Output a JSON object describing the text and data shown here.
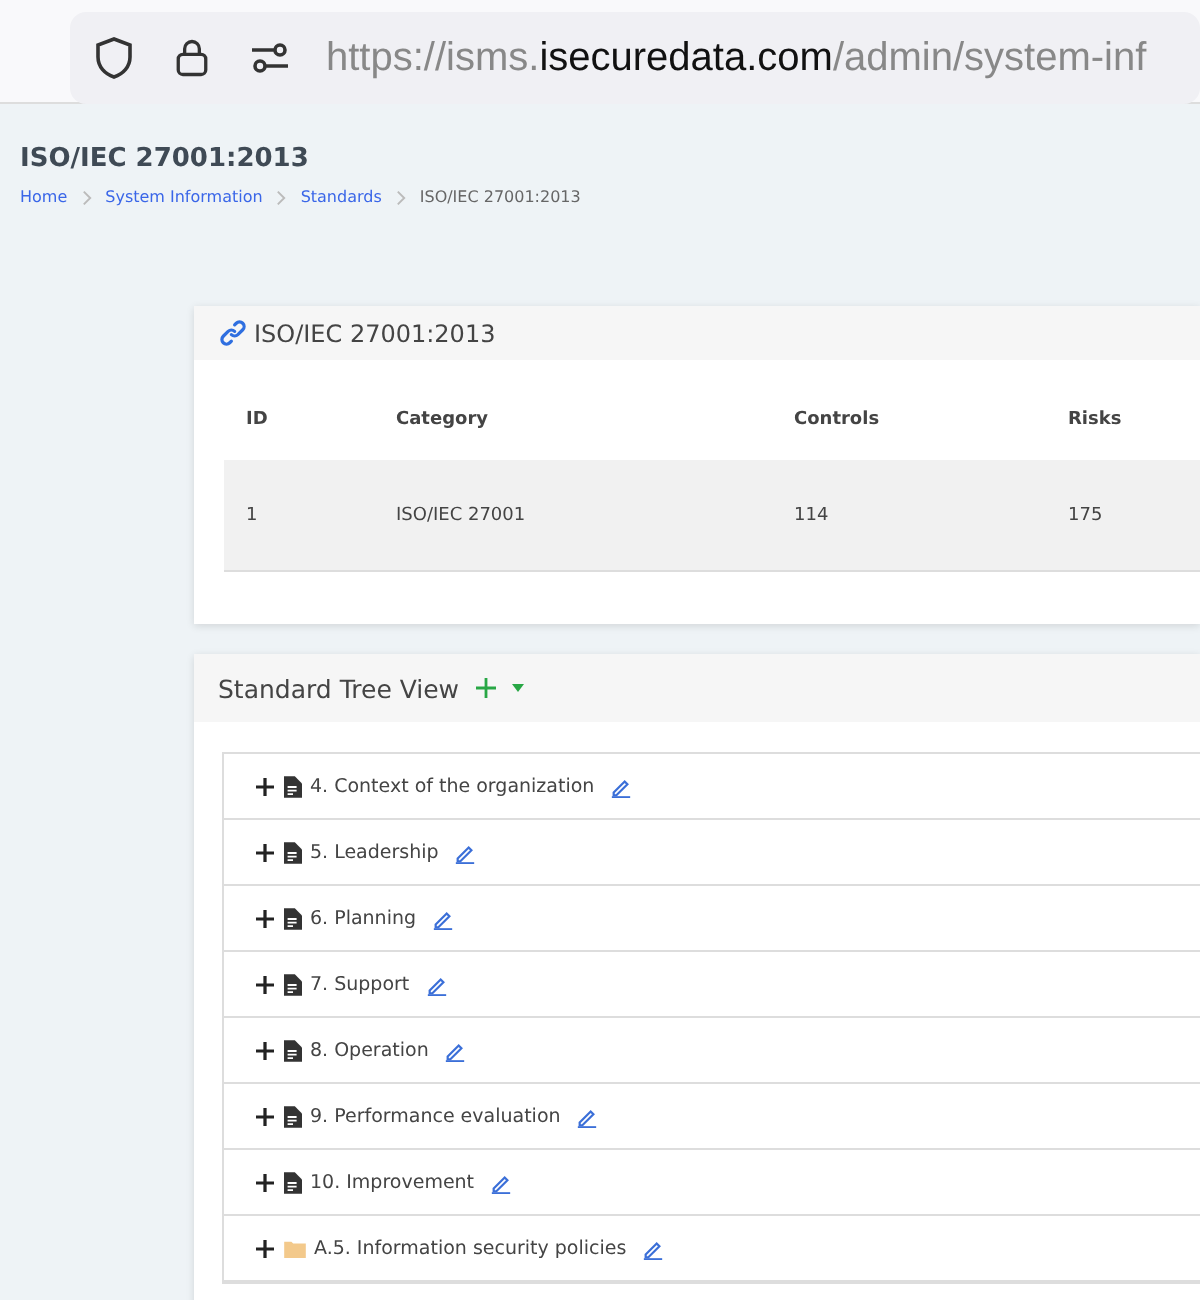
{
  "browser": {
    "url": {
      "prefix": "https://isms.",
      "domain": "isecuredata.com",
      "path": "/admin/system-inf"
    }
  },
  "page": {
    "title": "ISO/IEC 27001:2013",
    "breadcrumb": [
      {
        "label": "Home",
        "link": true
      },
      {
        "label": "System Information",
        "link": true
      },
      {
        "label": "Standards",
        "link": true
      },
      {
        "label": "ISO/IEC 27001:2013",
        "link": false
      }
    ]
  },
  "standard_card": {
    "title": "ISO/IEC 27001:2013",
    "table": {
      "columns": [
        "ID",
        "Category",
        "Controls",
        "Risks"
      ],
      "rows": [
        [
          "1",
          "ISO/IEC 27001",
          "114",
          "175"
        ]
      ]
    }
  },
  "tree_card": {
    "title": "Standard Tree View",
    "items": [
      {
        "label": "4. Context of the organization",
        "kind": "document",
        "expanded": false
      },
      {
        "label": "5. Leadership",
        "kind": "document",
        "expanded": false
      },
      {
        "label": "6. Planning",
        "kind": "document",
        "expanded": false
      },
      {
        "label": "7. Support",
        "kind": "document",
        "expanded": false
      },
      {
        "label": "8. Operation",
        "kind": "document",
        "expanded": false
      },
      {
        "label": "9. Performance evaluation",
        "kind": "document",
        "expanded": false
      },
      {
        "label": "10. Improvement",
        "kind": "document",
        "expanded": false
      },
      {
        "label": "A.5. Information security policies",
        "kind": "folder",
        "expanded": false
      }
    ]
  }
}
